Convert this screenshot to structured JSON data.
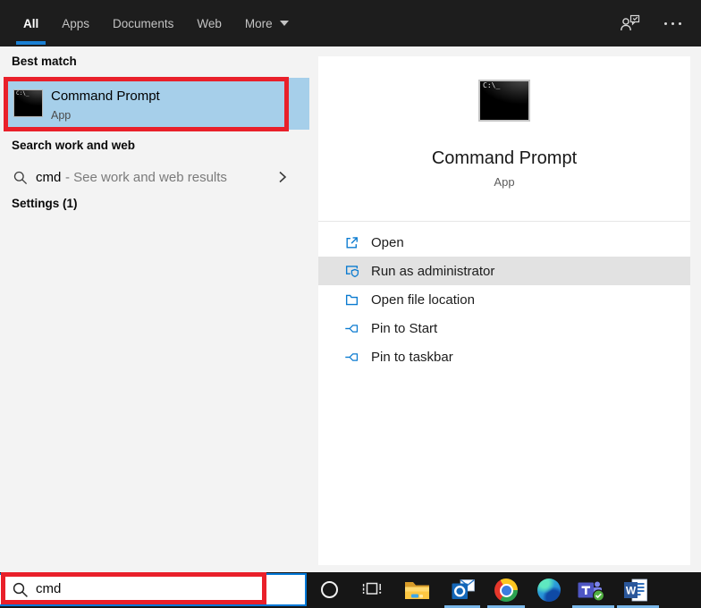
{
  "topbar": {
    "tabs": [
      {
        "label": "All",
        "selected": true
      },
      {
        "label": "Apps",
        "selected": false
      },
      {
        "label": "Documents",
        "selected": false
      },
      {
        "label": "Web",
        "selected": false
      },
      {
        "label": "More",
        "selected": false,
        "has_dropdown": true
      }
    ]
  },
  "left_panel": {
    "best_match_header": "Best match",
    "best_match": {
      "title": "Command Prompt",
      "subtitle": "App"
    },
    "search_header": "Search work and web",
    "web_search": {
      "query": "cmd",
      "suffix": "- See work and web results"
    },
    "settings_header": "Settings (1)"
  },
  "preview": {
    "app_name": "Command Prompt",
    "app_type": "App",
    "actions": [
      {
        "label": "Open",
        "icon": "open-external-icon",
        "highlighted": false
      },
      {
        "label": "Run as administrator",
        "icon": "shield-window-icon",
        "highlighted": true
      },
      {
        "label": "Open file location",
        "icon": "folder-open-icon",
        "highlighted": false
      },
      {
        "label": "Pin to Start",
        "icon": "pin-icon",
        "highlighted": false
      },
      {
        "label": "Pin to taskbar",
        "icon": "pin-icon",
        "highlighted": false
      }
    ]
  },
  "taskbar": {
    "search_value": "cmd",
    "icons": [
      "cortana",
      "task-view",
      "file-explorer",
      "outlook",
      "chrome",
      "edge",
      "teams",
      "word"
    ],
    "running_apps": [
      "outlook",
      "chrome",
      "teams",
      "word"
    ]
  },
  "cmd_icon": {
    "prompt_marks": "C:\\_"
  },
  "colors": {
    "accent_blue": "#0078d7",
    "best_match_highlight": "#a6cfea",
    "annotation_red": "#e9202a",
    "action_row_highlight": "#e2e2e2",
    "tab_underline": "#1a80d4",
    "running_indicator": "#79b7e9"
  }
}
